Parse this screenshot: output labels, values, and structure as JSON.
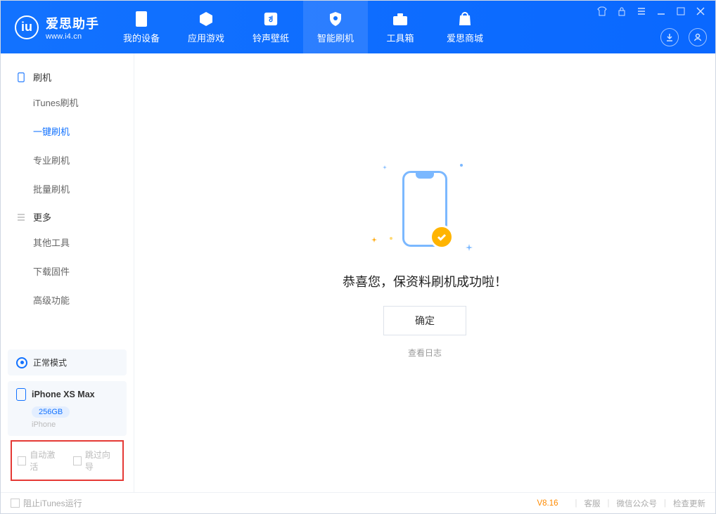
{
  "app": {
    "name": "爱思助手",
    "url": "www.i4.cn"
  },
  "tabs": [
    {
      "label": "我的设备"
    },
    {
      "label": "应用游戏"
    },
    {
      "label": "铃声壁纸"
    },
    {
      "label": "智能刷机"
    },
    {
      "label": "工具箱"
    },
    {
      "label": "爱思商城"
    }
  ],
  "sidebar": {
    "section1": "刷机",
    "items1": [
      "iTunes刷机",
      "一键刷机",
      "专业刷机",
      "批量刷机"
    ],
    "section2": "更多",
    "items2": [
      "其他工具",
      "下载固件",
      "高级功能"
    ]
  },
  "status": {
    "mode": "正常模式"
  },
  "device": {
    "name": "iPhone XS Max",
    "storage": "256GB",
    "type": "iPhone"
  },
  "checkboxes": {
    "auto_activate": "自动激活",
    "skip_guide": "跳过向导"
  },
  "result": {
    "message": "恭喜您，保资料刷机成功啦！",
    "ok": "确定",
    "log": "查看日志"
  },
  "statusbar": {
    "block_itunes": "阻止iTunes运行",
    "version": "V8.16",
    "links": [
      "客服",
      "微信公众号",
      "检查更新"
    ]
  }
}
